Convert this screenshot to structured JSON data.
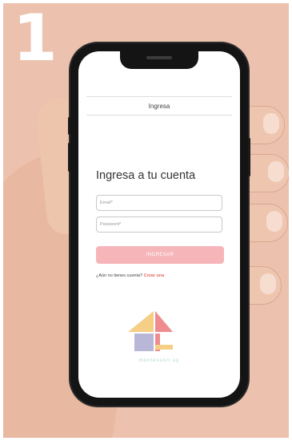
{
  "step": "1",
  "app": {
    "header_title": "Ingresa",
    "page_title": "Ingresa a tu cuenta",
    "email_placeholder": "Email*",
    "password_placeholder": "Password*",
    "submit_label": "INGRESAR",
    "signup_prompt": "¿Aún no tienes cuenta?",
    "signup_link": "Crear una",
    "logo_text": "montessori uy"
  },
  "colors": {
    "background": "#ecc2ae",
    "button": "#f6b5b8",
    "link": "#e36d62",
    "logo_yellow": "#f6cf86",
    "logo_pink": "#ee8d8f",
    "logo_lavender": "#b9b7d8",
    "logo_text": "#a9d7cf"
  },
  "icons": [
    "montessori-logo-icon"
  ]
}
